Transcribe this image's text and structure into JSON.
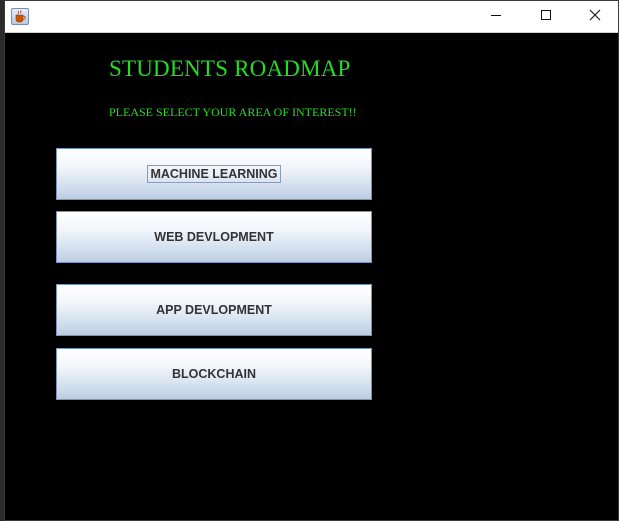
{
  "window": {
    "icon": "java-cup-icon",
    "controls": {
      "minimize": "minimize-icon",
      "maximize": "maximize-icon",
      "close": "close-icon"
    }
  },
  "header": {
    "title": "STUDENTS ROADMAP",
    "subtitle": "PLEASE SELECT YOUR AREA OF INTEREST!!"
  },
  "areas": [
    {
      "label": "MACHINE LEARNING",
      "focused": true
    },
    {
      "label": "WEB DEVLOPMENT",
      "focused": false
    },
    {
      "label": "APP DEVLOPMENT",
      "focused": false
    },
    {
      "label": "BLOCKCHAIN",
      "focused": false
    }
  ],
  "colors": {
    "background": "#000000",
    "heading": "#22dd22",
    "button_text": "#333333",
    "button_border": "#7a93b8"
  }
}
